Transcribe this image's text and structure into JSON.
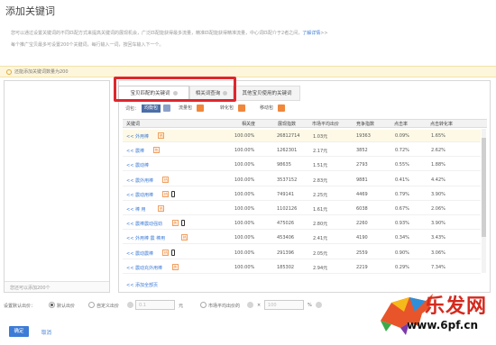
{
  "dialog": {
    "title": "添加关键词"
  },
  "description": {
    "line1_text": "您可以通过设置关键词的不同匹配方式来提高关键词的展现机会，广泛匹配能获得最多流量，精准匹配能获得精准流量，中心词匹配介于2者之间，",
    "line1_link": "了解详情",
    "line1_tail": ">>",
    "line2": "每个推广宝贝最多可设置200个关键词，每行输入一词，按回车输入下一个。"
  },
  "notice": {
    "text": "还能添加关键词数量为200"
  },
  "left_panel": {
    "footer": "您还可以添加200个"
  },
  "tabs": [
    {
      "label": "宝贝匹配的关键词",
      "active": true
    },
    {
      "label": "相关词查询",
      "active": false
    },
    {
      "label": "其他宝贝使用的关键词",
      "active": false
    }
  ],
  "filter": {
    "label": "词包：",
    "pills": [
      {
        "label": "均衡包",
        "active": true
      },
      {
        "label": "流量包",
        "active": false
      },
      {
        "label": "转化包",
        "active": false
      },
      {
        "label": "移动包",
        "active": false
      }
    ]
  },
  "table": {
    "columns": [
      "关键词",
      "相关度",
      "展现指数",
      "市场平均出价",
      "竞争指数",
      "点击率",
      "点击转化率"
    ],
    "rows": [
      {
        "keyword": "<< 外用棒",
        "tag": "热",
        "phone": false,
        "relevance": "100.00%",
        "impressions": "26812714",
        "avg_bid": "1.03元",
        "competition": "19363",
        "ctr": "0.09%",
        "cvr": "1.65%"
      },
      {
        "keyword": "<< 震棒",
        "tag": "热",
        "phone": false,
        "relevance": "100.00%",
        "impressions": "1262301",
        "avg_bid": "2.17元",
        "competition": "3852",
        "ctr": "0.72%",
        "cvr": "2.62%"
      },
      {
        "keyword": "<< 震动棒",
        "tag": "",
        "phone": false,
        "relevance": "100.00%",
        "impressions": "98635",
        "avg_bid": "1.51元",
        "competition": "2793",
        "ctr": "0.55%",
        "cvr": "1.88%"
      },
      {
        "keyword": "<< 震外用棒",
        "tag": "热",
        "phone": false,
        "relevance": "100.00%",
        "impressions": "3537152",
        "avg_bid": "2.83元",
        "competition": "9881",
        "ctr": "0.41%",
        "cvr": "4.42%"
      },
      {
        "keyword": "<< 震动用棒",
        "tag": "热",
        "phone": true,
        "relevance": "100.00%",
        "impressions": "749141",
        "avg_bid": "2.25元",
        "competition": "4469",
        "ctr": "0.79%",
        "cvr": "3.90%"
      },
      {
        "keyword": "<< 棒 用",
        "tag": "热",
        "phone": false,
        "relevance": "100.00%",
        "impressions": "1102126",
        "avg_bid": "1.61元",
        "competition": "6038",
        "ctr": "0.67%",
        "cvr": "2.06%"
      },
      {
        "keyword": "<< 震棒震动强劲",
        "tag": "热",
        "phone": true,
        "relevance": "100.00%",
        "impressions": "475026",
        "avg_bid": "2.80元",
        "competition": "2260",
        "ctr": "0.93%",
        "cvr": "3.90%"
      },
      {
        "keyword": "<< 外用棒 震 棒用",
        "tag": "热",
        "phone": false,
        "relevance": "100.00%",
        "impressions": "453406",
        "avg_bid": "2.41元",
        "competition": "4190",
        "ctr": "0.34%",
        "cvr": "3.43%"
      },
      {
        "keyword": "<< 震动震棒",
        "tag": "热",
        "phone": true,
        "relevance": "100.00%",
        "impressions": "291396",
        "avg_bid": "2.05元",
        "competition": "2559",
        "ctr": "0.90%",
        "cvr": "3.06%"
      },
      {
        "keyword": "<< 震动充外用棒",
        "tag": "热",
        "phone": false,
        "relevance": "100.00%",
        "impressions": "185302",
        "avg_bid": "2.94元",
        "competition": "2219",
        "ctr": "0.29%",
        "cvr": "7.34%"
      }
    ],
    "add_all": "<< 添加全部页"
  },
  "bid": {
    "label": "设置默认出价：",
    "option_default": "默认出价",
    "option_custom": "自定义出价",
    "custom_placeholder": "0.1",
    "unit": "元",
    "option_market": "市场平均出价的",
    "market_placeholder": "100",
    "percent": "%"
  },
  "buttons": {
    "ok": "确定",
    "cancel": "取消"
  },
  "watermark": {
    "brand": "乐发网",
    "url": "www.6pf.cn"
  },
  "colors": {
    "accent": "#3c7bd6",
    "highlight_border": "#e0262d",
    "notice_bg": "#fdf6dc",
    "tag": "#f08030"
  }
}
